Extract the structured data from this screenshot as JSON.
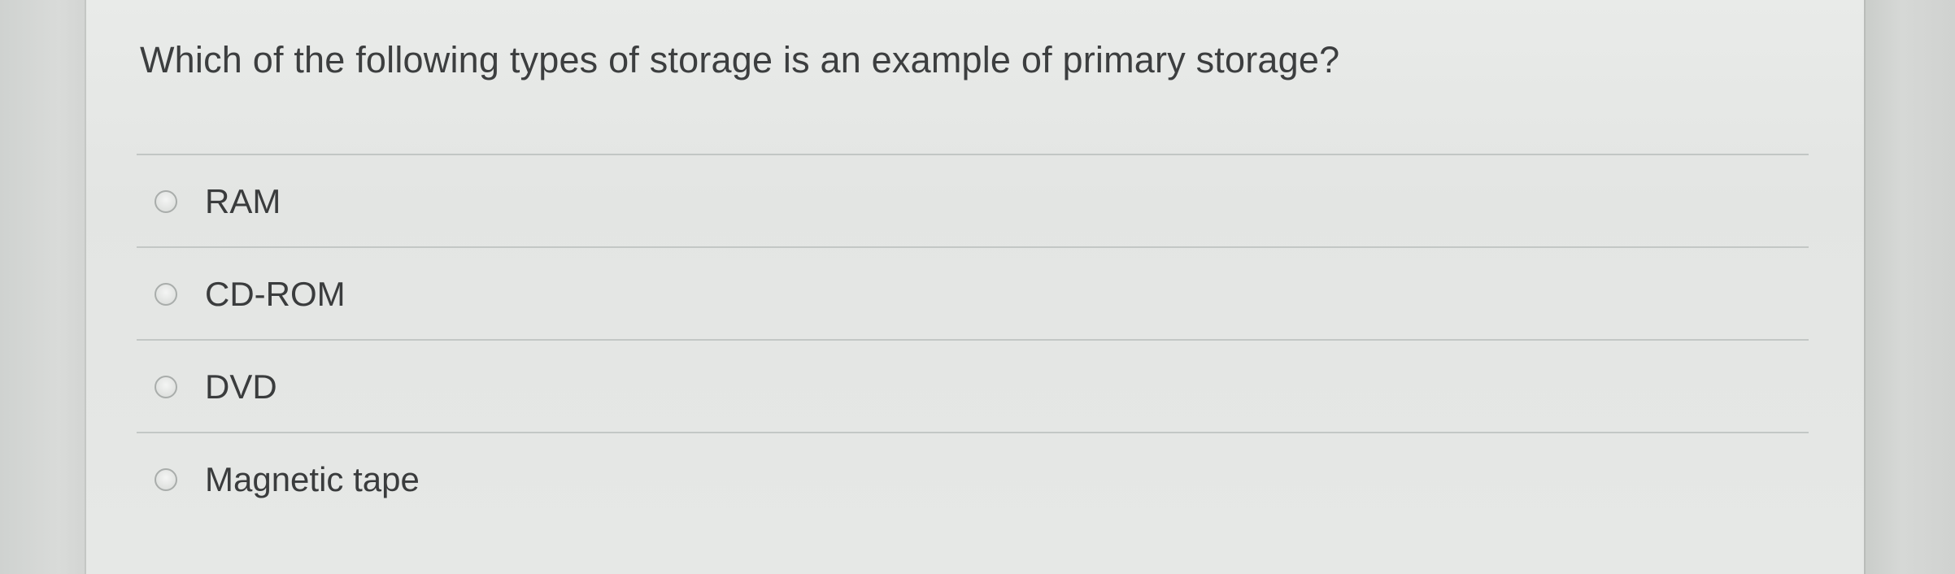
{
  "question": {
    "text": "Which of the following types of storage is an example of primary storage?"
  },
  "options": [
    {
      "label": "RAM",
      "selected": false
    },
    {
      "label": "CD-ROM",
      "selected": false
    },
    {
      "label": "DVD",
      "selected": false
    },
    {
      "label": "Magnetic tape",
      "selected": false
    }
  ],
  "colors": {
    "text": "#3a3c3d",
    "divider": "#c3c7c5",
    "panel_background": "#e6e8e6"
  }
}
